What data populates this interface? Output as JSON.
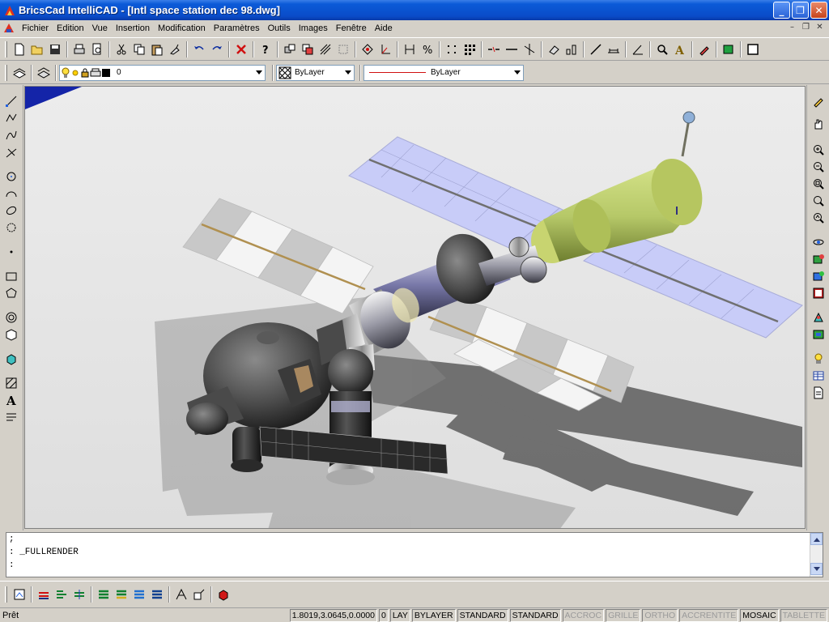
{
  "window": {
    "title": "BricsCad IntelliCAD - [Intl space station dec 98.dwg]"
  },
  "menu": [
    "Fichier",
    "Edition",
    "Vue",
    "Insertion",
    "Modification",
    "Paramètres",
    "Outils",
    "Images",
    "Fenêtre",
    "Aide"
  ],
  "layer_bar": {
    "layer_value": "0",
    "linetype_value": "ByLayer",
    "lineweight_value": "ByLayer"
  },
  "command_history": [
    ";",
    ": _FULLRENDER",
    ":"
  ],
  "status": {
    "ready": "Prêt",
    "coords": "1.8019,3.0645,0.0000",
    "elevation": "0",
    "layer": "LAY",
    "color": "BYLAYER",
    "text_style": "STANDARD",
    "dim_style": "STANDARD",
    "toggles": [
      {
        "label": "ACCROC",
        "on": false
      },
      {
        "label": "GRILLE",
        "on": false
      },
      {
        "label": "ORTHO",
        "on": false
      },
      {
        "label": "ACCRENTITE",
        "on": false
      },
      {
        "label": "MOSAIC",
        "on": true
      },
      {
        "label": "TABLETTE",
        "on": false
      }
    ]
  },
  "colors": {
    "titlebar": "#0a4cc9",
    "viewport_bg": "#e6e6e6",
    "solar_panel_blue": "#c8ccf8",
    "module_green": "#b8cc70"
  }
}
